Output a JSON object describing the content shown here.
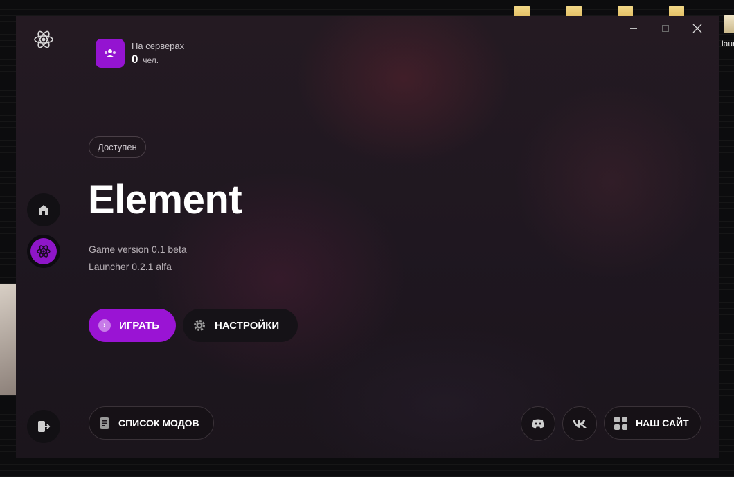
{
  "window": {
    "controls": {
      "minimize": "—",
      "maximize": "☐",
      "close": "✕"
    }
  },
  "desktop": {
    "file_label": "laun"
  },
  "sidebar": {
    "logo_icon": "atom-icon",
    "items": [
      {
        "name": "home",
        "icon": "home-icon"
      },
      {
        "name": "element",
        "icon": "atom-icon",
        "active": true
      }
    ],
    "exit_icon": "exit-icon"
  },
  "servers": {
    "label": "На серверах",
    "count": "0",
    "unit": "чел."
  },
  "status": {
    "label": "Доступен"
  },
  "game": {
    "title": "Element",
    "game_version": "Game version 0.1 beta",
    "launcher_version": "Launcher 0.2.1 alfa"
  },
  "actions": {
    "play_label": "ИГРАТЬ",
    "settings_label": "НАСТРОЙКИ",
    "mods_label": "СПИСОК МОДОВ",
    "site_label": "НАШ САЙТ"
  },
  "social": {
    "discord_icon": "discord-icon",
    "vk_icon": "vk-icon"
  },
  "colors": {
    "accent": "#9414d1",
    "background": "#221a22",
    "button_dark": "#151217"
  }
}
